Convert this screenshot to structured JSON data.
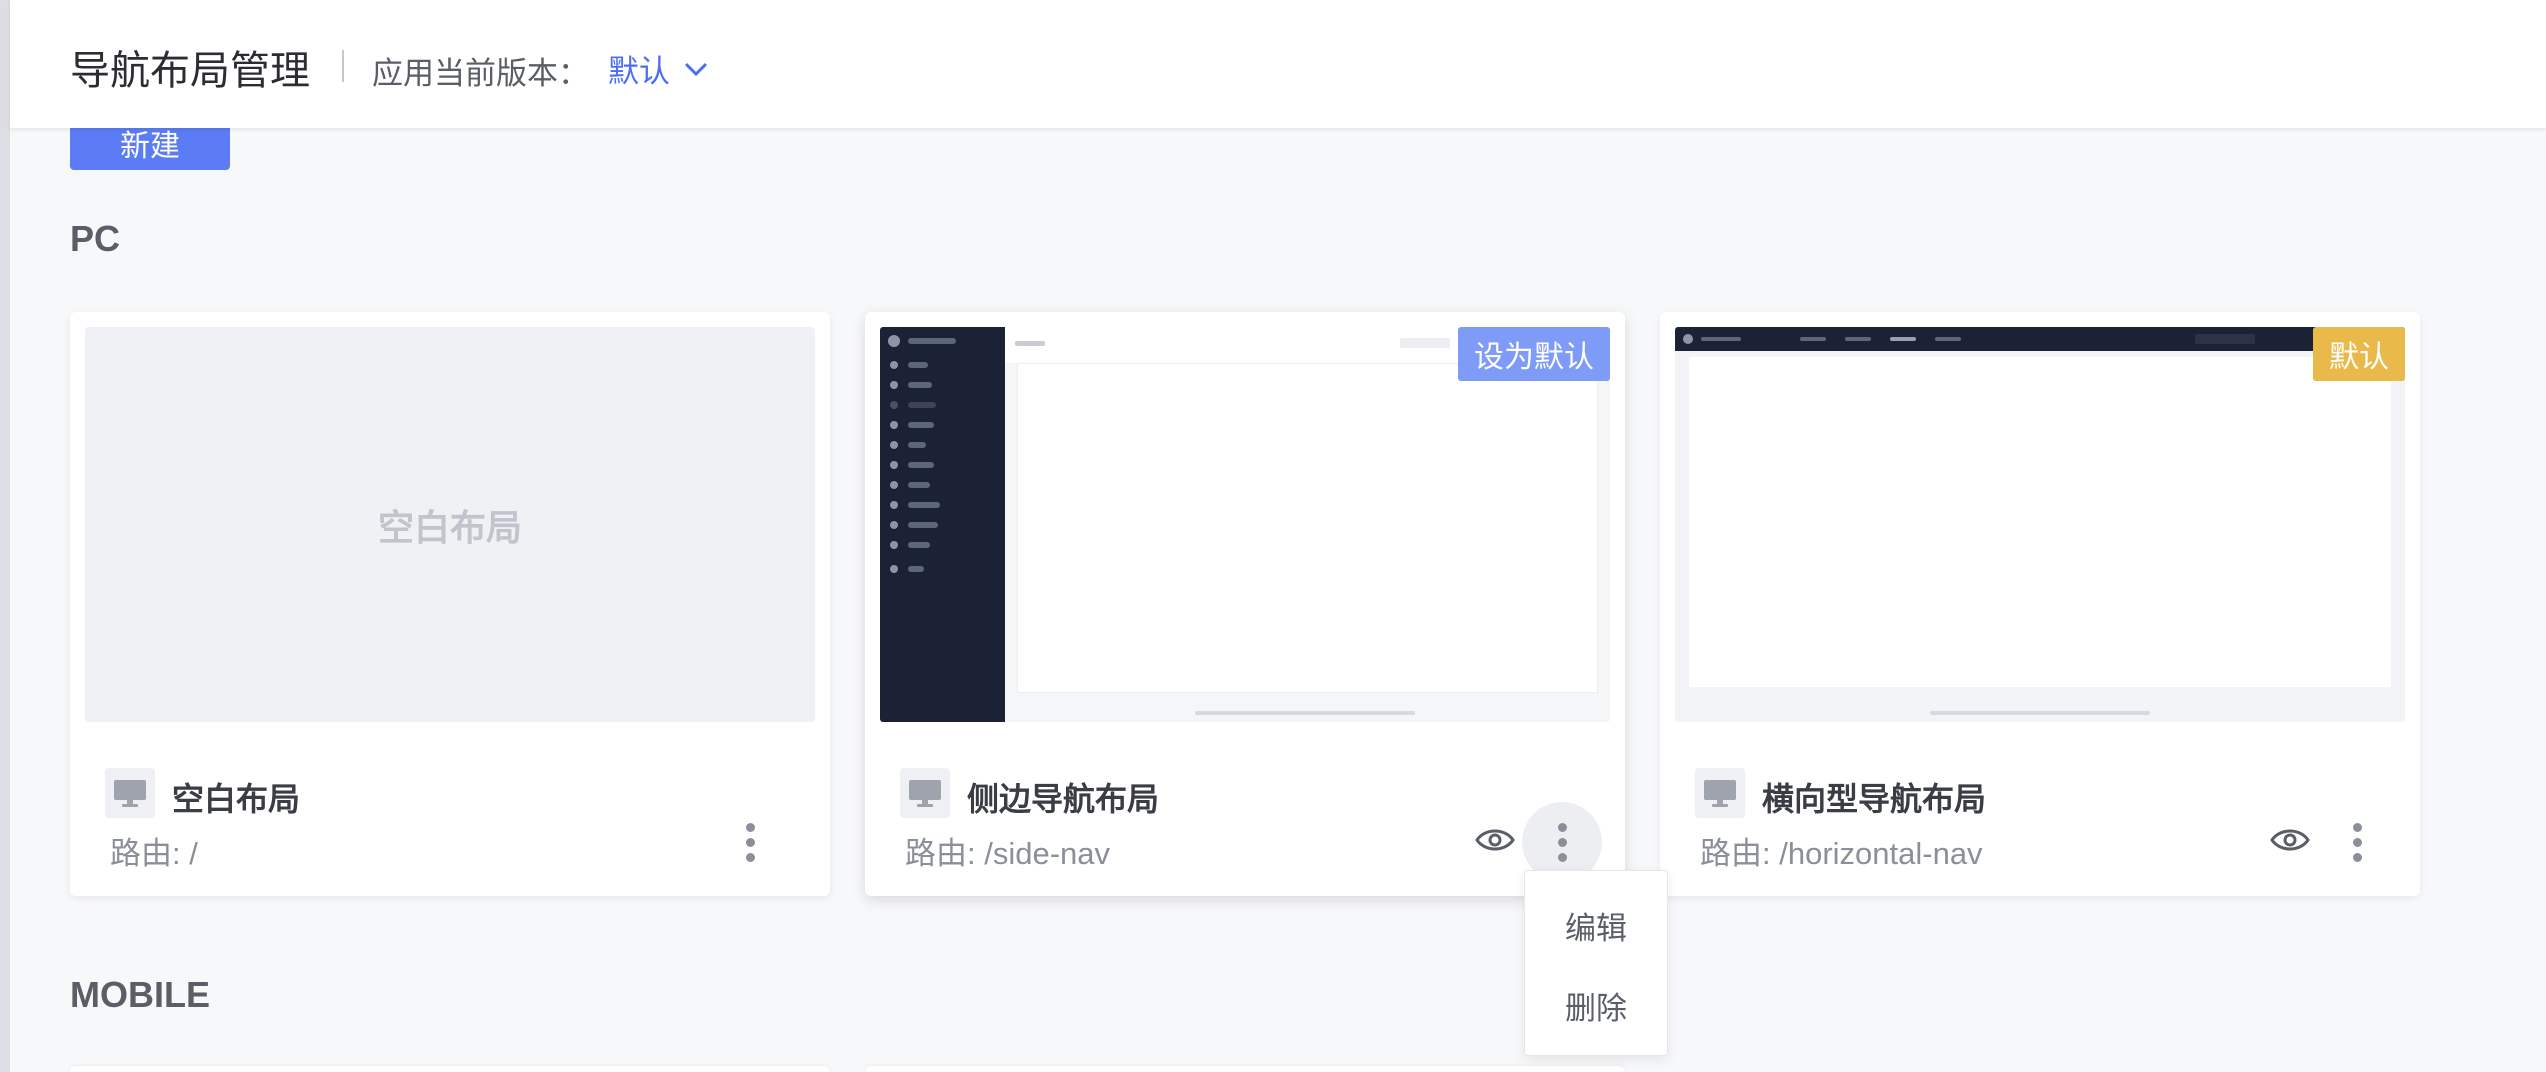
{
  "header": {
    "title": "导航布局管理",
    "version_label": "应用当前版本：",
    "version_value": "默认"
  },
  "toolbar": {
    "new_label": "新建"
  },
  "sections": {
    "pc": "PC",
    "mobile": "MOBILE"
  },
  "cards": [
    {
      "name": "空白布局",
      "route": "路由: /",
      "thumb_text": "空白布局",
      "badge": "",
      "has_preview": false
    },
    {
      "name": "侧边导航布局",
      "route": "路由: /side-nav",
      "badge": "设为默认",
      "badge_color": "#7f9bf8",
      "has_preview": true
    },
    {
      "name": "横向型导航布局",
      "route": "路由: /horizontal-nav",
      "badge": "默认",
      "badge_color": "#e9b94a",
      "has_preview": true
    }
  ],
  "dropdown": {
    "items": [
      "编辑",
      "删除"
    ]
  },
  "colors": {
    "primary": "#5b7cf5",
    "link": "#4c6ef5",
    "dark_nav": "#1c2236"
  },
  "icons": [
    "chevron-down-icon",
    "monitor-icon",
    "eye-icon",
    "more-vertical-icon"
  ]
}
